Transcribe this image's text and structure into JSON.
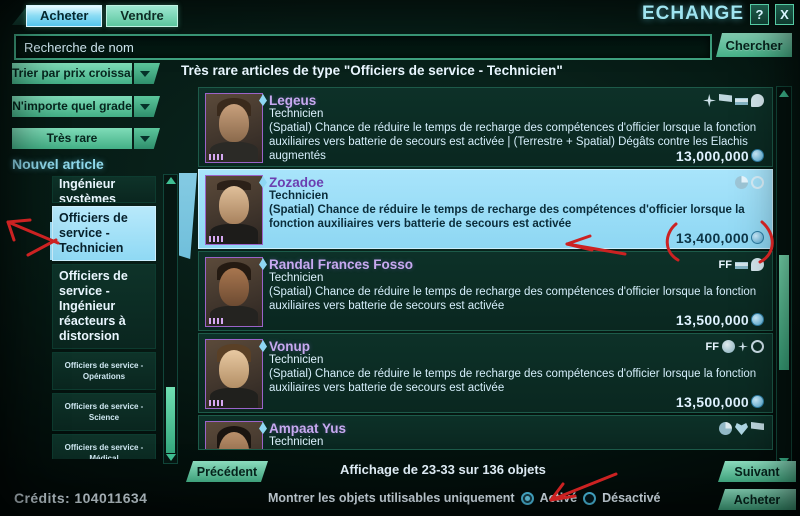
{
  "window": {
    "title": "ECHANGE",
    "help_label": "?",
    "close_label": "X"
  },
  "tabs": [
    {
      "label": "Acheter",
      "active": true
    },
    {
      "label": "Vendre",
      "active": false
    }
  ],
  "search": {
    "placeholder": "Recherche de nom",
    "value": "",
    "button_label": "Chercher"
  },
  "filters": [
    {
      "label": "Trier par prix croissant"
    },
    {
      "label": "N'importe quel grade"
    },
    {
      "label": "Très rare"
    }
  ],
  "sidebar": {
    "new_item_label": "Nouvel article",
    "categories": [
      {
        "label": "Ingénieur systèmes",
        "selected": false,
        "clipped": true
      },
      {
        "label": "Officiers de service - Technicien",
        "selected": true
      },
      {
        "label": "Officiers de service - Ingénieur réacteurs à distorsion",
        "selected": false
      },
      {
        "label": "Officiers de service - Opérations",
        "selected": false,
        "small": true
      },
      {
        "label": "Officiers de service - Science",
        "selected": false,
        "small": true
      },
      {
        "label": "Officiers de service - Médical",
        "selected": false,
        "small": true
      }
    ]
  },
  "main": {
    "panel_title": "Très rare articles de type \"Officiers de service - Technicien\"",
    "items": [
      {
        "name": "Legeus",
        "type": "Technicien",
        "description": "(Spatial) Chance de réduire le temps de recharge des compétences d'officier lorsque la fonction auxiliaires vers batterie de secours est activée | (Terrestre + Spatial) Dégâts contre les Elachis augmentés",
        "price": "13,000,000",
        "traits": [
          "spark-icon",
          "flag-icon",
          "stack-icon",
          "bubble-icon"
        ],
        "selected": false
      },
      {
        "name": "Zozadoe",
        "type": "Technicien",
        "description": "(Spatial) Chance de réduire le temps de recharge des compétences d'officier lorsque la fonction auxiliaires vers batterie de secours est activée",
        "price": "13,400,000",
        "traits": [
          "clock-icon",
          "ring-icon"
        ],
        "selected": true
      },
      {
        "name": "Randal Frances Fosso",
        "type": "Technicien",
        "description": "(Spatial) Chance de réduire le temps de recharge des compétences d'officier lorsque la fonction auxiliaires vers batterie de secours est activée",
        "price": "13,500,000",
        "traits": [
          "FF",
          "stack-icon",
          "bubble-icon"
        ],
        "selected": false
      },
      {
        "name": "Vonup",
        "type": "Technicien",
        "description": "(Spatial) Chance de réduire le temps de recharge des compétences d'officier lorsque la fonction auxiliaires vers batterie de secours est activée",
        "price": "13,500,000",
        "traits": [
          "FF",
          "disc-icon",
          "spark-icon",
          "ring-icon"
        ],
        "selected": false
      },
      {
        "name": "Ampaat Yus",
        "type": "Technicien",
        "description": "",
        "price": "",
        "traits": [
          "clock-icon",
          "heart-icon",
          "flag-icon"
        ],
        "selected": false
      }
    ]
  },
  "footer": {
    "prev_label": "Précédent",
    "next_label": "Suivant",
    "buy_label": "Acheter",
    "display_count": "Affichage de 23-33 sur 136 objets",
    "usable_only_label": "Montrer les objets utilisables uniquement",
    "radio_on_label": "Activé",
    "radio_off_label": "Désactivé",
    "radio_selected": "on",
    "credits_label": "Crédits: 104011634"
  },
  "colors": {
    "accent_green": "#46b389",
    "selection_blue": "#8ed7f3",
    "title_cyan": "#9fe4f0",
    "annotation_red": "#cc2222"
  }
}
